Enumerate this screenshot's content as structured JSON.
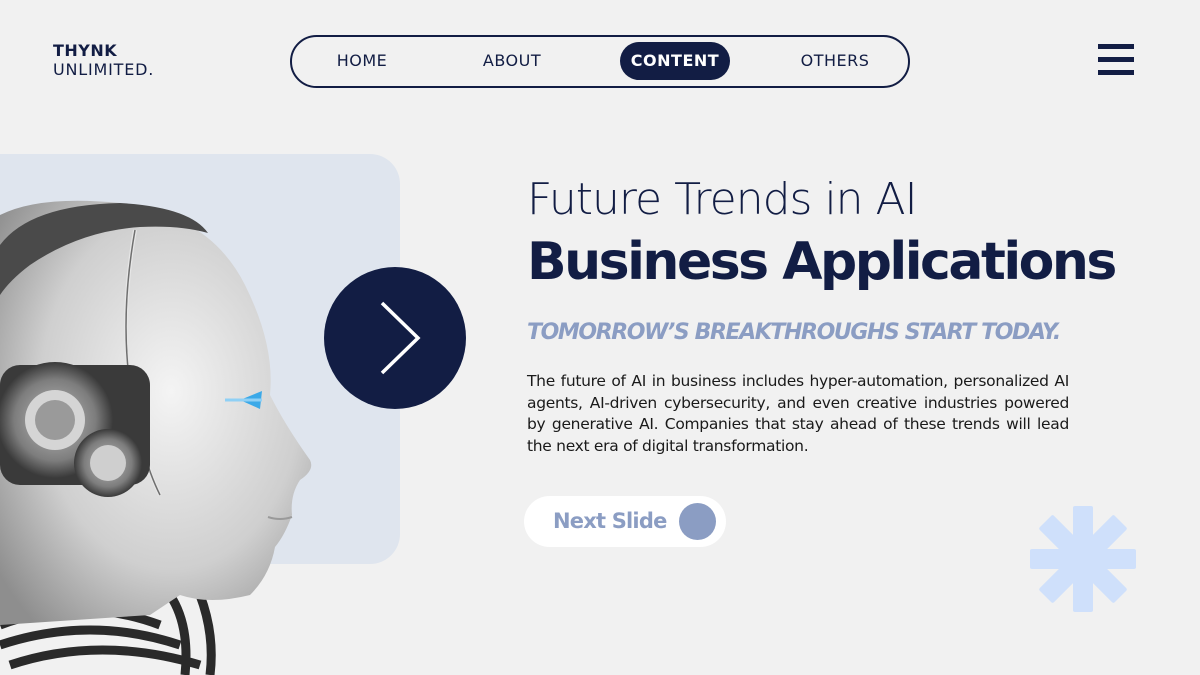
{
  "brand": {
    "line1": "THYNK",
    "line2": "UNLIMITED."
  },
  "nav": {
    "items": [
      {
        "label": "HOME",
        "active": false
      },
      {
        "label": "ABOUT",
        "active": false
      },
      {
        "label": "CONTENT",
        "active": true
      },
      {
        "label": "OTHERS",
        "active": false
      }
    ]
  },
  "icons": {
    "menu": "hamburger-menu-icon",
    "next": "chevron-right-icon",
    "decor": "asterisk-icon"
  },
  "hero": {
    "title_line1": "Future Trends in AI",
    "title_line2": "Business Applications",
    "tagline": "TOMORROW’S BREAKTHROUGHS START TODAY.",
    "body": "The future of AI in business includes hyper-automation, personalized AI agents, AI-driven cybersecurity, and even creative industries powered by generative AI. Companies that stay ahead of these trends will lead the next era of digital transformation."
  },
  "cta": {
    "label": "Next Slide"
  },
  "colors": {
    "navy": "#121d44",
    "accent": "#8b9dc3",
    "panel": "#dfe5ee",
    "asterisk": "#cfe0fb",
    "background": "#f1f1f1"
  }
}
